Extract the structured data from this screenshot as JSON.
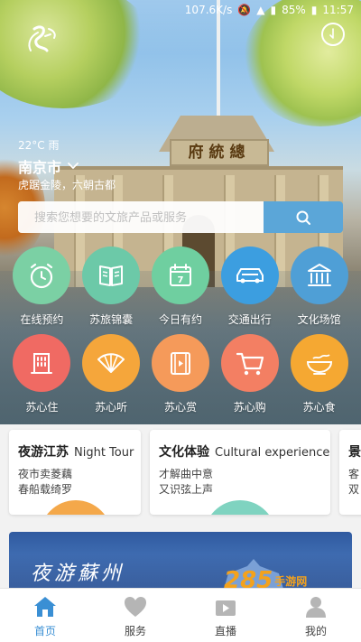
{
  "status_bar": {
    "speed": "107.6K/s",
    "battery": "85%",
    "time": "11:57"
  },
  "brand": {
    "logo_icon": "suzhou-swan-logo-icon"
  },
  "weather": {
    "text": "22°C 雨"
  },
  "city": {
    "name": "南京市"
  },
  "slogan": "虎踞金陵，六朝古都",
  "search": {
    "placeholder": "搜索您想要的文旅产品或服务",
    "icon": "search-icon"
  },
  "services_row1": [
    {
      "label": "在线预约",
      "icon": "alarm-clock-icon",
      "color": "#7bd0a4"
    },
    {
      "label": "苏旅锦囊",
      "icon": "book-icon",
      "color": "#6cc9a8"
    },
    {
      "label": "今日有约",
      "icon": "calendar-icon",
      "color": "#6fcfa0"
    },
    {
      "label": "交通出行",
      "icon": "car-icon",
      "color": "#3c9ee0"
    },
    {
      "label": "文化场馆",
      "icon": "museum-icon",
      "color": "#4f9fd6"
    }
  ],
  "services_row2": [
    {
      "label": "苏心住",
      "icon": "building-icon",
      "color": "#f06a63"
    },
    {
      "label": "苏心听",
      "icon": "fan-icon",
      "color": "#f5a63b"
    },
    {
      "label": "苏心赏",
      "icon": "film-icon",
      "color": "#f59a5a"
    },
    {
      "label": "苏心购",
      "icon": "cart-icon",
      "color": "#f37f63"
    },
    {
      "label": "苏心食",
      "icon": "noodle-bowl-icon",
      "color": "#f5a832"
    }
  ],
  "cards": [
    {
      "title_cn": "夜游江苏",
      "title_en": "Night Tour",
      "line1": "夜市卖菱藕",
      "line2": "春船载绮罗",
      "accent": "#f4a84a"
    },
    {
      "title_cn": "文化体验",
      "title_en": "Cultural experience",
      "line1": "才解曲中意",
      "line2": "又识弦上声",
      "accent": "#7fd3c0"
    },
    {
      "title_cn": "景",
      "title_en": "",
      "line1": "客",
      "line2": "双",
      "accent": "#9ab6e0"
    }
  ],
  "banner": {
    "text": "夜游蘇州"
  },
  "watermark": {
    "big": "285",
    "small": "手游网"
  },
  "nav": [
    {
      "label": "首页",
      "icon": "home-icon",
      "active": true
    },
    {
      "label": "服务",
      "icon": "heart-icon",
      "active": false
    },
    {
      "label": "直播",
      "icon": "live-camera-icon",
      "active": false
    },
    {
      "label": "我的",
      "icon": "person-icon",
      "active": false
    }
  ]
}
